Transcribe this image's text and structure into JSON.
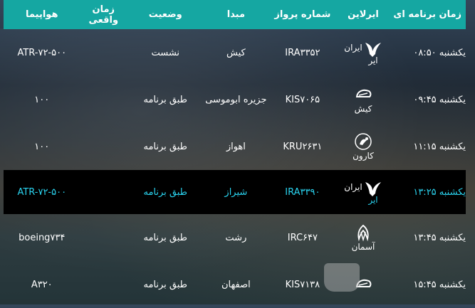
{
  "header": {
    "scheduled_time": "زمان برنامه ای",
    "airline": "ایرلاین",
    "flight_number": "شماره پرواز",
    "origin": "مبدا",
    "status": "وضعیت",
    "actual_time": "زمان واقعی",
    "aircraft": "هواپیما"
  },
  "rows": [
    {
      "scheduled_time": "یکشنبه ۰۸:۵۰",
      "airline": "ایران ایر",
      "airline_top": "ایران",
      "airline_bottom": "ایر",
      "logo_icon": "iran-air-homa-icon",
      "flight_number": "IRA۳۳۵۲",
      "origin": "کیش",
      "status": "نشست",
      "actual_time": "",
      "aircraft": "ATR-۷۲-۵۰۰"
    },
    {
      "scheduled_time": "یکشنبه ۰۹:۴۵",
      "airline": "کیش",
      "logo_icon": "kish-air-icon",
      "flight_number": "KIS۷۰۶۵",
      "origin": "جزیره ابوموسی",
      "status": "طبق برنامه",
      "actual_time": "",
      "aircraft": "۱۰۰"
    },
    {
      "scheduled_time": "یکشنبه ۱۱:۱۵",
      "airline": "کارون",
      "logo_icon": "karun-air-icon",
      "flight_number": "KRU۲۶۳۱",
      "origin": "اهواز",
      "status": "طبق برنامه",
      "actual_time": "",
      "aircraft": "۱۰۰"
    },
    {
      "scheduled_time": "یکشنبه ۱۳:۲۵",
      "airline": "ایران ایر",
      "airline_top": "ایران",
      "airline_bottom": "ایر",
      "logo_icon": "iran-air-homa-icon",
      "flight_number": "IRA۳۳۹۰",
      "origin": "شیراز",
      "status": "طبق برنامه",
      "actual_time": "",
      "aircraft": "ATR-۷۲-۵۰۰"
    },
    {
      "scheduled_time": "یکشنبه ۱۳:۴۵",
      "airline": "آسمان",
      "logo_icon": "aseman-icon",
      "flight_number": "IRC۶۴۷",
      "origin": "رشت",
      "status": "طبق برنامه",
      "actual_time": "",
      "aircraft": "boeing۷۳۴"
    },
    {
      "scheduled_time": "یکشنبه ۱۵:۴۵",
      "airline": "",
      "logo_icon": "kish-air-icon",
      "flight_number": "KIS۷۱۳۸",
      "origin": "اصفهان",
      "status": "طبق برنامه",
      "actual_time": "",
      "aircraft": "A۳۲۰"
    }
  ]
}
